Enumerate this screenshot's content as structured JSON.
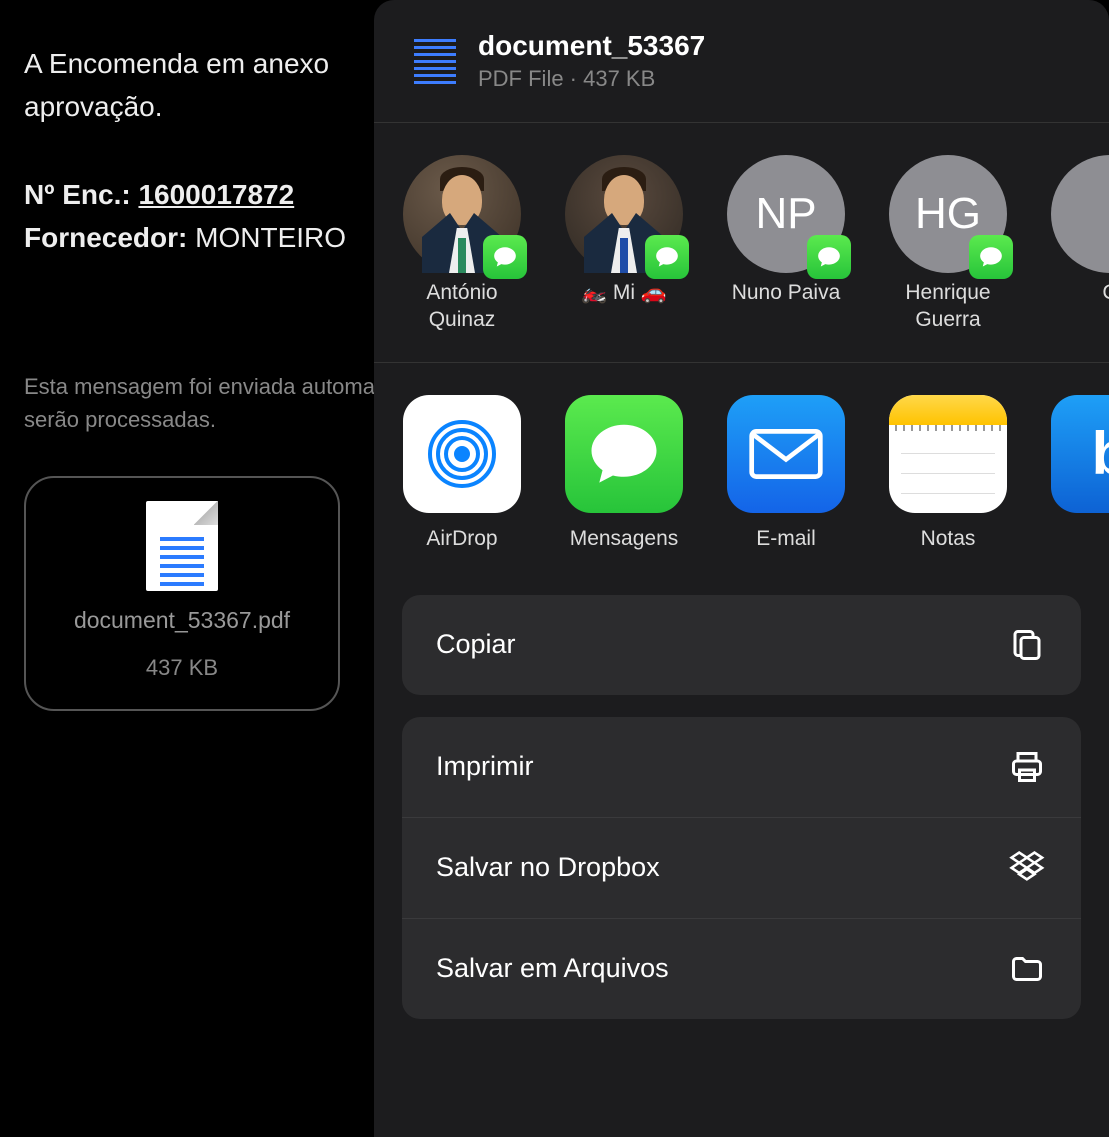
{
  "background": {
    "line1": "A Encomenda em anexo",
    "line2": "aprovação.",
    "order_label": "Nº Enc.:",
    "order_number": "1600017872",
    "supplier_label": "Fornecedor:",
    "supplier_value": "MONTEIRO",
    "auto_line1": "Esta mensagem foi enviada automati",
    "auto_line2": "serão processadas.",
    "attachment_name": "document_53367.pdf",
    "attachment_size": "437 KB"
  },
  "sheet": {
    "title": "document_53367",
    "meta": "PDF File · 437 KB"
  },
  "contacts": [
    {
      "name": "António Quinaz",
      "initials": "",
      "photo": true
    },
    {
      "name": "🏍️  Mi  🚗",
      "initials": "",
      "photo": true
    },
    {
      "name": "Nuno Paiva",
      "initials": "NP",
      "photo": false
    },
    {
      "name": "Henrique Guerra",
      "initials": "HG",
      "photo": false
    },
    {
      "name": "C",
      "initials": "",
      "photo": false
    }
  ],
  "apps": [
    {
      "label": "AirDrop"
    },
    {
      "label": "Mensagens"
    },
    {
      "label": "E-mail"
    },
    {
      "label": "Notas"
    },
    {
      "label": ""
    }
  ],
  "actions": {
    "copy": "Copiar",
    "print": "Imprimir",
    "dropbox": "Salvar no Dropbox",
    "files": "Salvar em Arquivos"
  }
}
